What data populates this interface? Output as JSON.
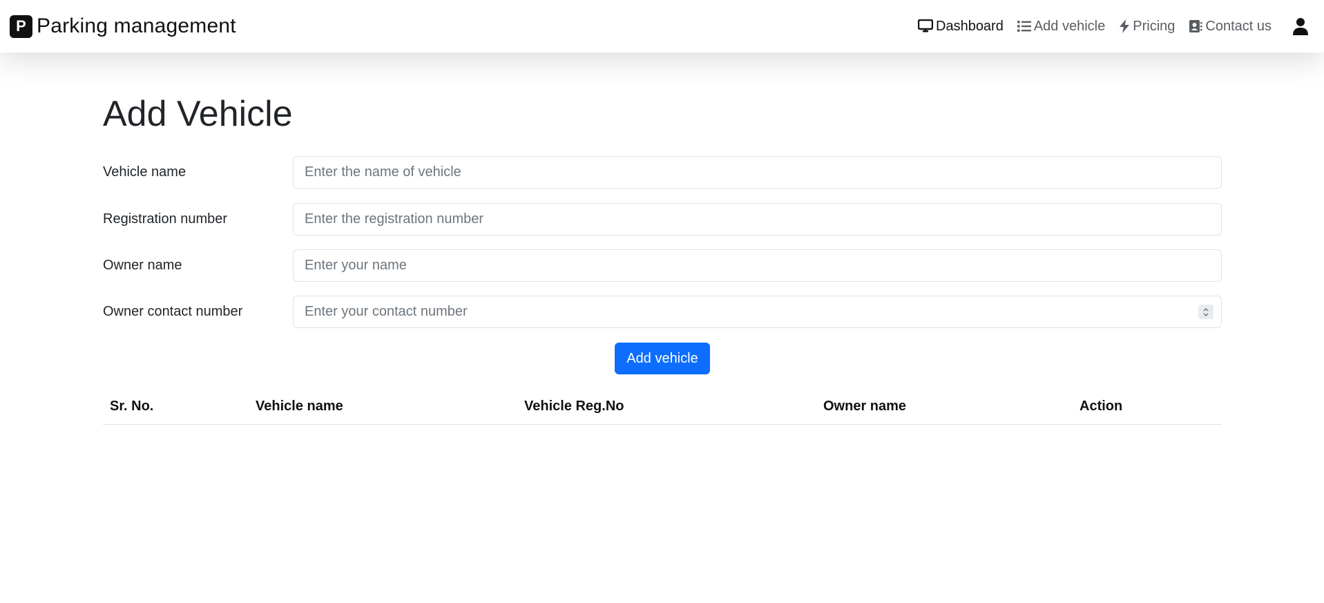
{
  "brand": {
    "logo_letter": "P",
    "title": "Parking management"
  },
  "nav": {
    "items": [
      {
        "label": "Dashboard",
        "icon": "monitor-icon",
        "active": true
      },
      {
        "label": "Add vehicle",
        "icon": "list-icon",
        "active": false
      },
      {
        "label": "Pricing",
        "icon": "lightning-icon",
        "active": false
      },
      {
        "label": "Contact us",
        "icon": "contact-card-icon",
        "active": false
      }
    ],
    "user_icon": "user-icon"
  },
  "page": {
    "title": "Add Vehicle"
  },
  "form": {
    "fields": [
      {
        "label": "Vehicle name",
        "value": "",
        "placeholder": "Enter the name of vehicle"
      },
      {
        "label": "Registration number",
        "value": "",
        "placeholder": "Enter the registration number"
      },
      {
        "label": "Owner name",
        "value": "",
        "placeholder": "Enter your name"
      },
      {
        "label": "Owner contact number",
        "value": "",
        "placeholder": "Enter your contact number"
      }
    ],
    "submit_label": "Add vehicle"
  },
  "table": {
    "headers": [
      "Sr. No.",
      "Vehicle name",
      "Vehicle Reg.No",
      "Owner name",
      "Action"
    ],
    "rows": []
  },
  "colors": {
    "primary": "#0d6efd",
    "text": "#212529",
    "muted": "#595d61"
  }
}
